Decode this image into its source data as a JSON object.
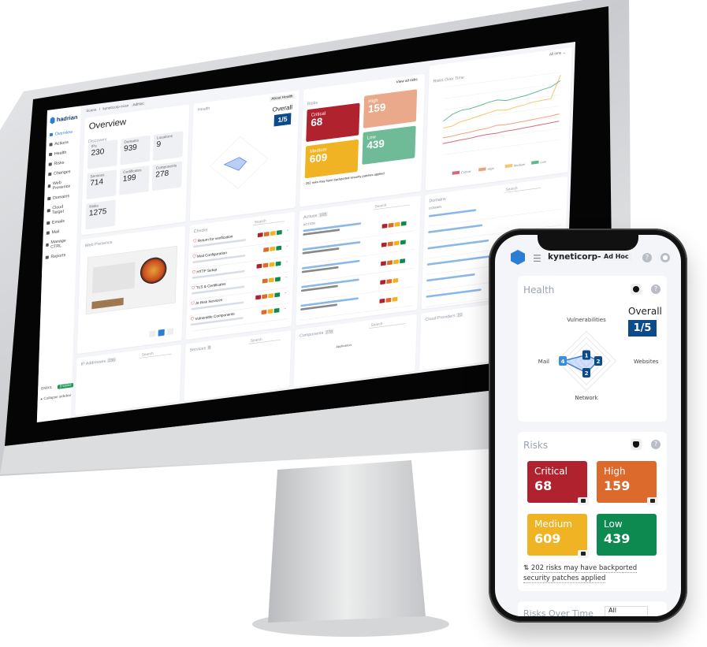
{
  "colors": {
    "critical": "#b0232e",
    "high": "#dc6a2c",
    "medium": "#f0b323",
    "low": "#0c8a4f",
    "brand": "#2a7fd4",
    "score_bg": "#0b4a8b"
  },
  "monitor": {
    "logo": "hadrian",
    "nav": [
      "Overview",
      "Actions",
      "Health",
      "Risks",
      "Changes",
      "Web Presence",
      "Domains",
      "Cloud Target",
      "Emails",
      "Mail",
      "Manage CTRL",
      "Reports"
    ],
    "sidebar_footer": {
      "email": "EMAIL",
      "badge": "Enabled",
      "collapse": "Collapse sidebar"
    },
    "breadcrumb": [
      "Scans",
      "/",
      "kyneticorp-scan",
      "AdHoc"
    ],
    "overview": {
      "title": "Overview",
      "discovery": "Discovery",
      "tiles": [
        {
          "label": "IPs",
          "value": "230"
        },
        {
          "label": "Domains",
          "value": "939"
        },
        {
          "label": "Locations",
          "value": "9"
        },
        {
          "label": "Services",
          "value": "714"
        },
        {
          "label": "Certificates",
          "value": "199"
        },
        {
          "label": "Components",
          "value": "278"
        },
        {
          "label": "Risks",
          "value": "1275"
        }
      ]
    },
    "health": {
      "title": "Health",
      "about": "About Health",
      "overall": "Overall",
      "score": "1/5"
    },
    "risks": {
      "title": "Risks",
      "view_all": "View all risks",
      "tiles": [
        {
          "label": "Critical",
          "value": "68"
        },
        {
          "label": "High",
          "value": "159"
        },
        {
          "label": "Medium",
          "value": "609"
        },
        {
          "label": "Low",
          "value": "439"
        }
      ],
      "footer": "202 risks may have backported security patches applied"
    },
    "risks_over_time": {
      "title": "Risks Over Time",
      "range": "All time",
      "legend": [
        "Critical",
        "High",
        "Medium",
        "Low"
      ],
      "series": {
        "Critical": [
          40,
          42,
          45,
          46,
          50,
          52,
          52,
          55,
          56,
          58,
          60,
          62,
          64,
          66
        ],
        "High": [
          60,
          62,
          66,
          68,
          72,
          74,
          80,
          78,
          80,
          82,
          84,
          86,
          88,
          92
        ],
        "Medium": [
          95,
          98,
          110,
          115,
          122,
          128,
          134,
          130,
          136,
          140,
          146,
          148,
          150,
          230
        ],
        "Low": [
          120,
          140,
          150,
          152,
          158,
          166,
          170,
          164,
          168,
          172,
          178,
          186,
          192,
          210
        ]
      }
    },
    "web_presence": {
      "title": "Web Presence"
    },
    "checks": {
      "title": "Checks",
      "search": "Search",
      "items": [
        "Return for verification",
        "Mail Configuration",
        "HTTP Setup",
        "TLS & Certificates",
        "At Risk Services",
        "Vulnerable Components"
      ]
    },
    "actions": {
      "title": "Actions",
      "count": "105",
      "search": "Search",
      "column": "ACTION"
    },
    "domains": {
      "title": "Domains",
      "search": "Search",
      "column": "DOMAIN"
    },
    "ip": {
      "title": "IP Addresses",
      "count": "230",
      "search": "Search"
    },
    "services": {
      "title": "Services",
      "count": "8",
      "search": "Search"
    },
    "components": {
      "title": "Components",
      "count": "278",
      "search": "Search",
      "type": "Application"
    },
    "cloud": {
      "title": "Cloud Providers",
      "count": "22"
    }
  },
  "phone": {
    "title": "kyneticorp-scan",
    "badge": "Ad Hoc",
    "health": {
      "title": "Health",
      "overall": "Overall",
      "score": "1/5",
      "axes": [
        {
          "label": "Vulnerabilities",
          "value": 1
        },
        {
          "label": "Websites",
          "value": 2
        },
        {
          "label": "Network",
          "value": 2
        },
        {
          "label": "Mail",
          "value": 4
        }
      ],
      "max": 5
    },
    "risks": {
      "title": "Risks",
      "tiles": [
        {
          "label": "Critical",
          "value": "68"
        },
        {
          "label": "High",
          "value": "159"
        },
        {
          "label": "Medium",
          "value": "609"
        },
        {
          "label": "Low",
          "value": "439"
        }
      ],
      "footer": "202 risks may have backported security patches applied"
    },
    "next_card": {
      "title": "Risks Over Time",
      "select": "All"
    }
  }
}
